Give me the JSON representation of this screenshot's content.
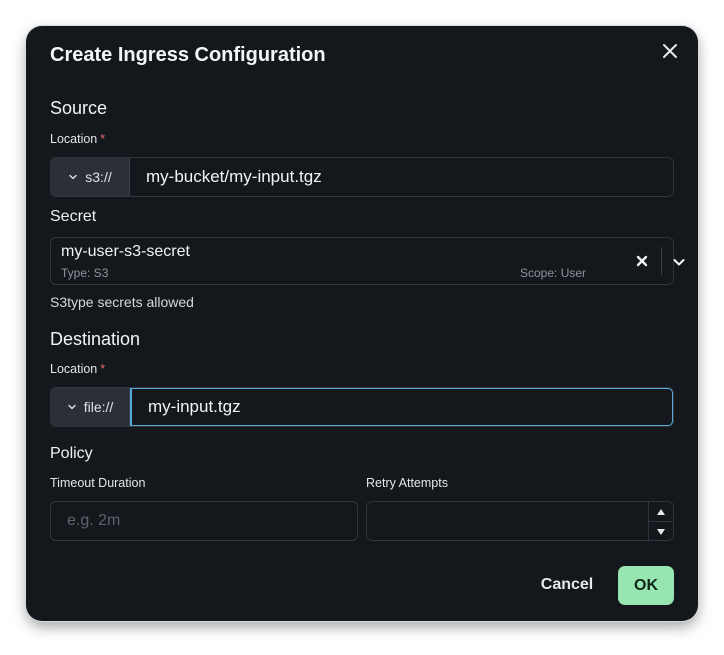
{
  "dialog": {
    "title": "Create Ingress Configuration",
    "cancel_label": "Cancel",
    "ok_label": "OK"
  },
  "source": {
    "heading": "Source",
    "location_label": "Location",
    "required_mark": "*",
    "prefix": "s3://",
    "value": "my-bucket/my-input.tgz",
    "secret_label": "Secret",
    "secret_name": "my-user-s3-secret",
    "secret_type": "Type: S3",
    "secret_scope": "Scope: User",
    "secret_hint": "S3type secrets allowed"
  },
  "destination": {
    "heading": "Destination",
    "location_label": "Location",
    "required_mark": "*",
    "prefix": "file://",
    "value": "my-input.tgz"
  },
  "policy": {
    "heading": "Policy",
    "timeout_label": "Timeout Duration",
    "timeout_placeholder": "e.g. 2m",
    "timeout_value": "",
    "retry_label": "Retry Attempts",
    "retry_value": ""
  },
  "icons": {
    "close": "close-icon",
    "prefix_dropdown": "chevron-down-icon",
    "clear": "clear-icon",
    "select_dropdown": "chevron-down-icon",
    "increment": "triangle-up-icon",
    "decrement": "triangle-down-icon"
  },
  "colors": {
    "dialog_bg": "#14181d",
    "focus_border": "#5aa9dc",
    "ok_button": "#97e6b2",
    "required": "#f06570"
  }
}
